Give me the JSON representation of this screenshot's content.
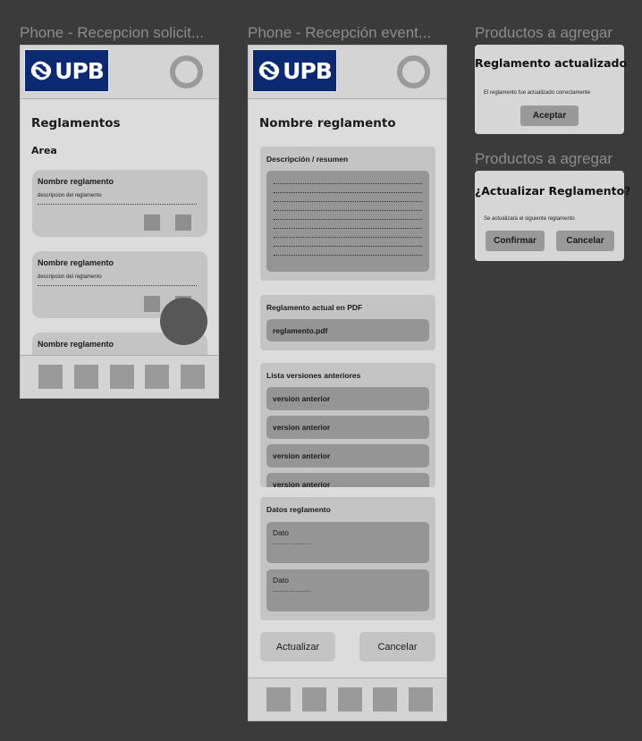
{
  "frames": {
    "frame1_title": "Phone - Recepcion solicit...",
    "frame2_title": "Phone - Recepción event...",
    "frame3_title": "Productos a agregar",
    "frame4_title": "Productos a agregar"
  },
  "brand": {
    "logo_text": "UPB",
    "logo_color": "#0c2a74"
  },
  "screen1": {
    "title": "Reglamentos",
    "area_label": "Area",
    "cards": [
      {
        "title": "Nombre reglamento",
        "desc": "descripcion del reglamento"
      },
      {
        "title": "Nombre reglamento",
        "desc": "descripcion del reglamento"
      },
      {
        "title": "Nombre reglamento"
      }
    ]
  },
  "screen2": {
    "title": "Nombre reglamento",
    "description_label": "Descripción / resumen",
    "pdf_label": "Reglamento actual en PDF",
    "pdf_file": "reglamento.pdf",
    "versions_label": "Lista versiones anteriores",
    "versions": [
      "version anterior",
      "version anterior",
      "version anterior",
      "version anterior"
    ],
    "data_label": "Datos reglamento",
    "data_fields": [
      {
        "label": "Dato",
        "value": "......................"
      },
      {
        "label": "Dato",
        "value": "......................"
      }
    ],
    "update_button": "Actualizar",
    "cancel_button": "Cancelar"
  },
  "dialog_success": {
    "title": "Reglamento actualizado",
    "message": "El reglamento fue actualizado correctamente",
    "accept_button": "Aceptar"
  },
  "dialog_confirm": {
    "title": "¿Actualizar Reglamento?",
    "message": "Se actualizará el siguiente reglamento",
    "confirm_button": "Confirmar",
    "cancel_button": "Cancelar"
  }
}
